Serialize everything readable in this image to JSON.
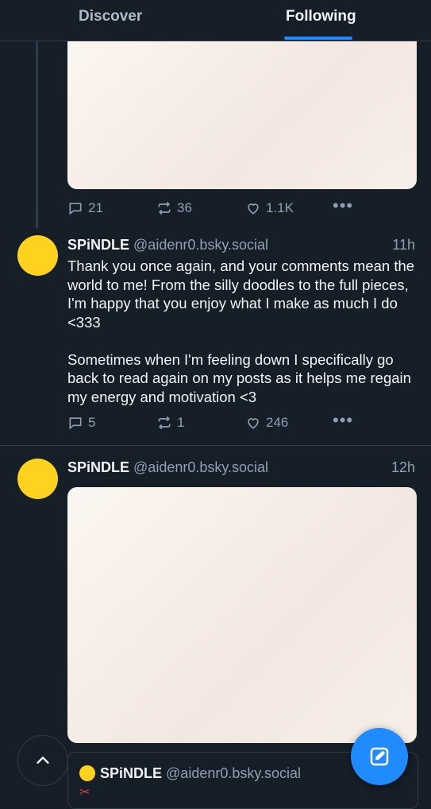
{
  "tabs": [
    {
      "label": "Discover"
    },
    {
      "label": "Following"
    }
  ],
  "posts": [
    {
      "stats": {
        "replies": "21",
        "reposts": "36",
        "likes": "1.1K"
      }
    },
    {
      "author": {
        "name": "SPiNDLE",
        "handle": "@aidenr0.bsky.social"
      },
      "time": "11h",
      "text": "Thank you once again, and your comments mean the world to me! From the silly doodles to the full pieces, I'm happy that you enjoy what I make as much I do <333\n\nSometimes when I'm feeling down I specifically go back to read again on my posts as it helps me regain my energy and motivation <3",
      "stats": {
        "replies": "5",
        "reposts": "1",
        "likes": "246"
      }
    },
    {
      "author": {
        "name": "SPiNDLE",
        "handle": "@aidenr0.bsky.social"
      },
      "time": "12h",
      "quote": {
        "name": "SPiNDLE",
        "handle": "@aidenr0.bsky.social",
        "emoji": "✂"
      }
    }
  ],
  "colors": {
    "accent": "#208bfe",
    "background": "#161e27",
    "muted": "#8ea0b4"
  },
  "icons": [
    "reply-icon",
    "repost-icon",
    "like-icon",
    "more-icon",
    "chevron-up-icon",
    "compose-icon"
  ]
}
